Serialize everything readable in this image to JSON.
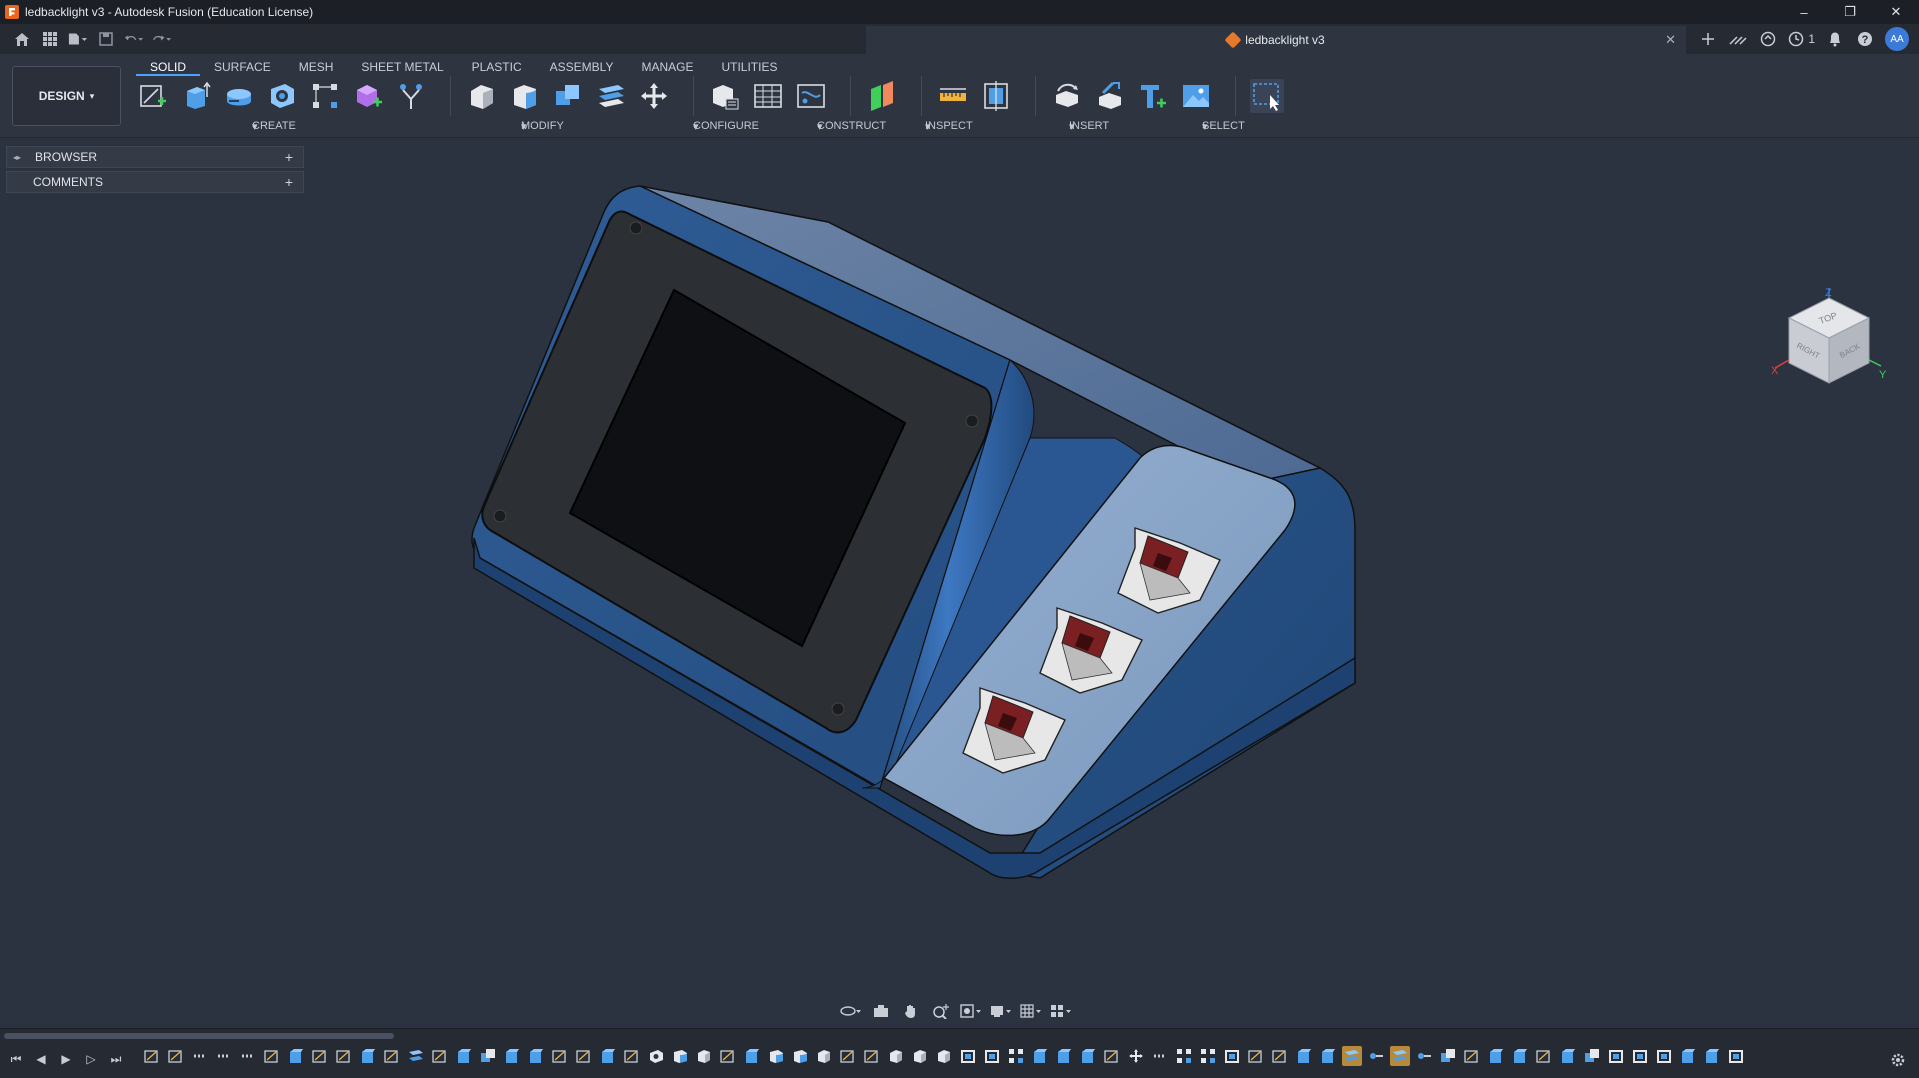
{
  "window": {
    "title": "ledbacklight v3 - Autodesk Fusion (Education License)",
    "minimize": "–",
    "maximize": "❐",
    "close": "✕"
  },
  "document_tab": {
    "label": "ledbacklight v3",
    "close": "✕"
  },
  "toolbar_right": {
    "notification_count": "1",
    "avatar": "AA"
  },
  "workspace": {
    "label": "DESIGN",
    "caret": "▾"
  },
  "tabs": [
    "SOLID",
    "SURFACE",
    "MESH",
    "SHEET METAL",
    "PLASTIC",
    "ASSEMBLY",
    "MANAGE",
    "UTILITIES"
  ],
  "active_tab": "SOLID",
  "groups": {
    "create": "CREATE",
    "modify": "MODIFY",
    "configure": "CONFIGURE",
    "construct": "CONSTRUCT",
    "inspect": "INSPECT",
    "insert": "INSERT",
    "select": "SELECT"
  },
  "browser": {
    "label": "BROWSER",
    "comments": "COMMENTS",
    "plus": "+"
  },
  "viewcube": {
    "top": "TOP",
    "right": "RIGHT",
    "back": "BACK",
    "x": "X",
    "y": "Y",
    "z": "Z"
  },
  "colors": {
    "body_blue": "#2f5a8e",
    "panel_light": "#7f9fc4",
    "screen": "#111316",
    "bezel": "#2b2e33",
    "accent": "#4aa3ff",
    "background": "#2b3240"
  }
}
